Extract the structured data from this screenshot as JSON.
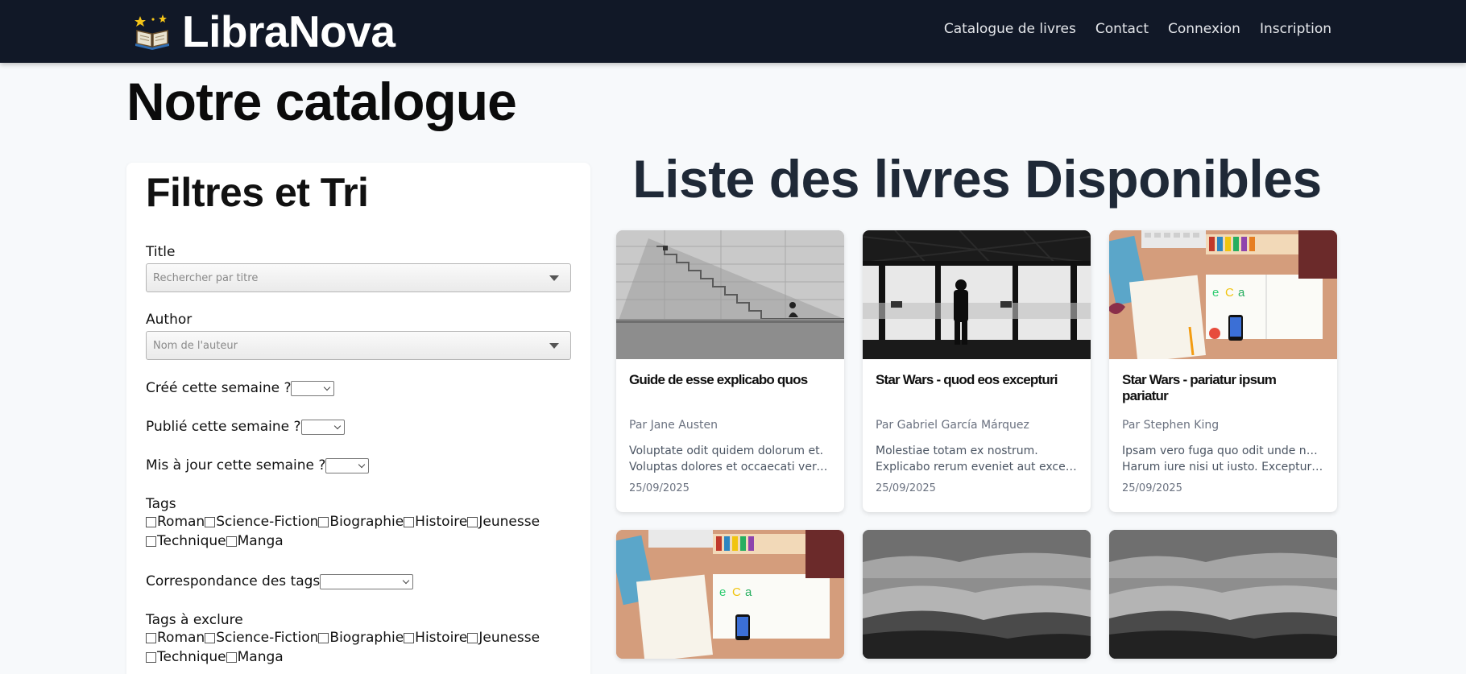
{
  "brand": {
    "name": "LibraNova",
    "logo_icon": "book-stars-icon"
  },
  "nav": [
    {
      "label": "Catalogue de livres"
    },
    {
      "label": "Contact"
    },
    {
      "label": "Connexion"
    },
    {
      "label": "Inscription"
    }
  ],
  "page_title": "Notre catalogue",
  "filters": {
    "heading": "Filtres et Tri",
    "title_label": "Title",
    "title_placeholder": "Rechercher par titre",
    "author_label": "Author",
    "author_placeholder": "Nom de l'auteur",
    "created_label": "Créé cette semaine ?",
    "published_label": "Publié cette semaine ?",
    "updated_label": "Mis à jour cette semaine ?",
    "tags_label": "Tags",
    "tags": [
      "Roman",
      "Science-Fiction",
      "Biographie",
      "Histoire",
      "Jeunesse",
      "Technique",
      "Manga"
    ],
    "match_label": "Correspondance des tags",
    "exclude_label": "Tags à exclure",
    "exclude_tags": [
      "Roman",
      "Science-Fiction",
      "Biographie",
      "Histoire",
      "Jeunesse",
      "Technique",
      "Manga"
    ]
  },
  "list_title": "Liste des livres Disponibles",
  "books": [
    {
      "title": "Guide de esse explicabo quos",
      "author": "Par Jane Austen",
      "desc_line1": "Voluptate odit quidem dolorum et.",
      "desc_line2": "Voluptas dolores et occaecati vero...",
      "date": "25/09/2025",
      "image": "stairs-photo"
    },
    {
      "title": "Star Wars - quod eos excepturi",
      "author": "Par Gabriel García Márquez",
      "desc_line1": "Molestiae totam ex nostrum.",
      "desc_line2": "Explicabo rerum eveniet aut except...",
      "date": "25/09/2025",
      "image": "hangar-photo"
    },
    {
      "title": "Star Wars - pariatur ipsum pariatur",
      "author": "Par Stephen King",
      "desc_line1": "Ipsam vero fuga quo odit unde nam.",
      "desc_line2": "Harum iure nisi ut iusto. Excepturi...",
      "date": "25/09/2025",
      "image": "desk-photo"
    }
  ],
  "colors": {
    "header_bg": "#111827",
    "list_title": "#1f2937",
    "page_bg": "#f7f9fb"
  }
}
